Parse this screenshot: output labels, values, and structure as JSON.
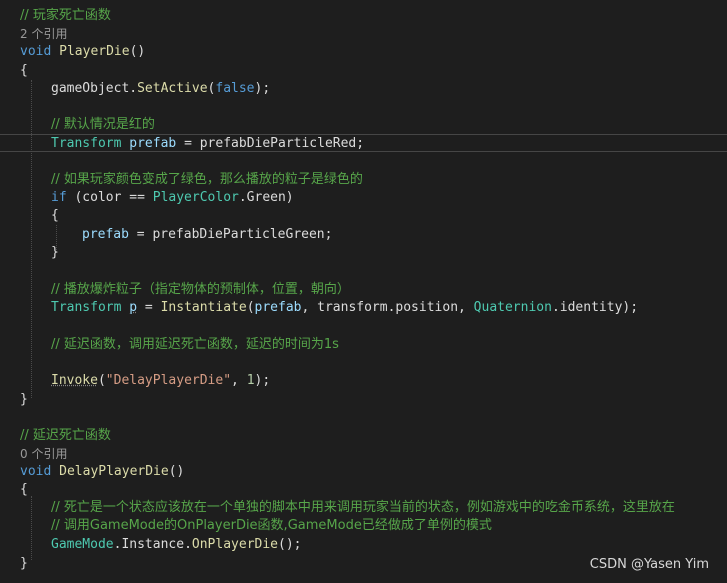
{
  "colors": {
    "background": "#1e1e1e",
    "keyword": "#569cd6",
    "type": "#4ec9b0",
    "method": "#dcdcaa",
    "identifier": "#9cdcfe",
    "comment": "#57a64a",
    "string": "#d69d85",
    "number": "#b5cea8"
  },
  "code": {
    "c1": "// 玩家死亡函数",
    "refs1": "2 个引用",
    "l3_kw": "void",
    "l3_name": "PlayerDie",
    "l3_rest": "()",
    "l4": "{",
    "l5_a": "gameObject.",
    "l5_m": "SetActive",
    "l5_b": "(",
    "l5_kw": "false",
    "l5_c": ");",
    "c2": "// 默认情况是红的",
    "l8_type": "Transform",
    "l8_var": "prefab",
    "l8_rest": " = prefabDieParticleRed;",
    "c3": "// 如果玩家颜色变成了绿色，那么播放的粒子是绿色的",
    "l11_kw": "if",
    "l11_a": " (color == ",
    "l11_type": "PlayerColor",
    "l11_b": ".Green)",
    "l12": "{",
    "l13_var": "prefab",
    "l13_rest": " = prefabDieParticleGreen;",
    "l14": "}",
    "c4": "// 播放爆炸粒子（指定物体的预制体，位置，朝向）",
    "l17_type": "Transform",
    "l17_var": "p",
    "l17_a": " = ",
    "l17_m": "Instantiate",
    "l17_b": "(",
    "l17_arg": "prefab",
    "l17_c": ", transform.position, ",
    "l17_type2": "Quaternion",
    "l17_d": ".identity);",
    "c5": "// 延迟函数，调用延迟死亡函数，延迟的时间为1s",
    "l21_m": "Invoke",
    "l21_a": "(",
    "l21_str": "\"DelayPlayerDie\"",
    "l21_b": ", ",
    "l21_num": "1",
    "l21_c": ");",
    "l22": "}",
    "c6": "// 延迟死亡函数",
    "refs2": "0 个引用",
    "l26_kw": "void",
    "l26_name": "DelayPlayerDie",
    "l26_rest": "()",
    "l27": "{",
    "c7": "// 死亡是一个状态应该放在一个单独的脚本中用来调用玩家当前的状态，例如游戏中的吃金币系统，这里放在",
    "c8": "// 调用GameMode的OnPlayerDie函数,GameMode已经做成了单例的模式",
    "l30_type": "GameMode",
    "l30_a": ".Instance.",
    "l30_m": "OnPlayerDie",
    "l30_b": "();",
    "l31": "}"
  },
  "watermark": "CSDN @Yasen Yim"
}
